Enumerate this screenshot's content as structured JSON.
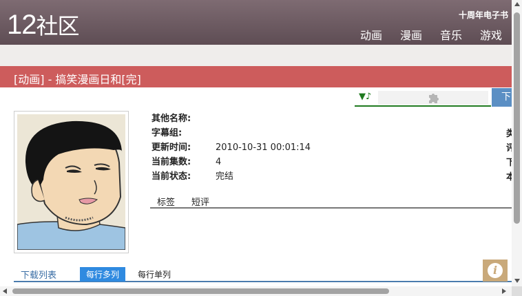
{
  "header": {
    "logo_num": "12",
    "logo_cn": "社区",
    "ebook": "十周年电子书",
    "nav": [
      "动画",
      "漫画",
      "音乐",
      "游戏"
    ]
  },
  "title": "[动画] - 搞笑漫画日和[完]",
  "player": {
    "note": "▼♪"
  },
  "download_button": "下",
  "info": {
    "rows": [
      {
        "label": "其他名称:",
        "value": ""
      },
      {
        "label": "字幕组:",
        "value": ""
      },
      {
        "label": "更新时间:",
        "value": "2010-10-31 00:01:14"
      },
      {
        "label": "当前集数:",
        "value": "4"
      },
      {
        "label": "当前状态:",
        "value": "完结"
      }
    ],
    "right_cut": [
      "类",
      "评",
      "下",
      "本"
    ]
  },
  "tabs": [
    "标签",
    "短评"
  ],
  "download": {
    "list_label": "下载列表",
    "multi": "每行多列",
    "single": "每行单列"
  },
  "info_icon": "i",
  "colors": {
    "header": "#6e5c63",
    "title_bar": "#cd5c5c",
    "accent_blue": "#2f8ae0"
  }
}
